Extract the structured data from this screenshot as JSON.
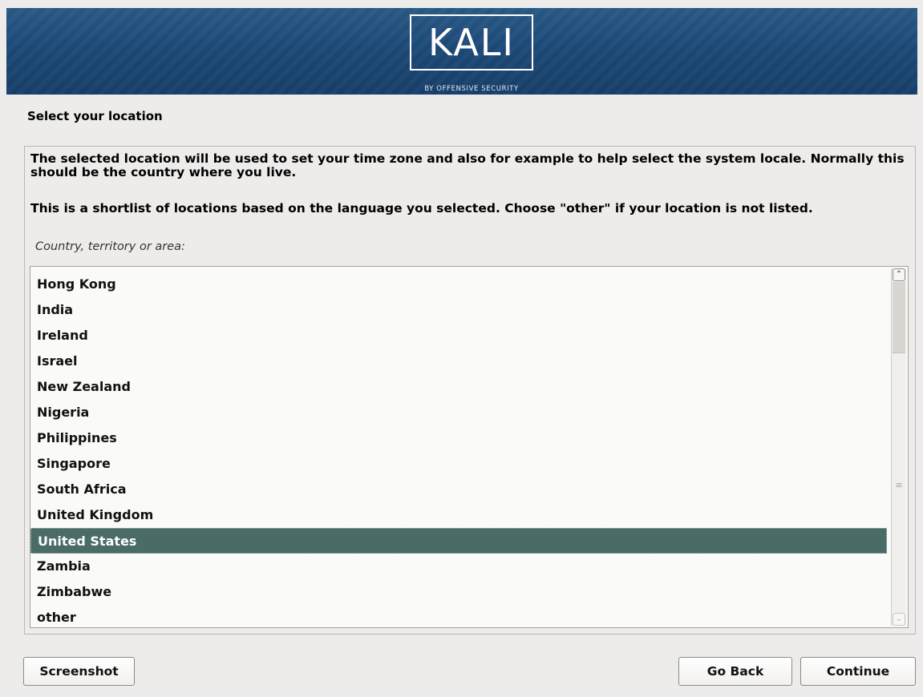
{
  "header": {
    "logo_text": "KALI",
    "logo_subtitle": "BY OFFENSIVE SECURITY"
  },
  "page": {
    "title": "Select your location",
    "description_1": "The selected location will be used to set your time zone and also for example to help select the system locale. Normally this should be the country where you live.",
    "description_2": "This is a shortlist of locations based on the language you selected. Choose \"other\" if your location is not listed.",
    "list_label": "Country, territory or area:"
  },
  "locations": {
    "items": [
      {
        "label": "Hong Kong"
      },
      {
        "label": "India"
      },
      {
        "label": "Ireland"
      },
      {
        "label": "Israel"
      },
      {
        "label": "New Zealand"
      },
      {
        "label": "Nigeria"
      },
      {
        "label": "Philippines"
      },
      {
        "label": "Singapore"
      },
      {
        "label": "South Africa"
      },
      {
        "label": "United Kingdom"
      },
      {
        "label": "United States",
        "selected": true
      },
      {
        "label": "Zambia"
      },
      {
        "label": "Zimbabwe"
      },
      {
        "label": "other"
      }
    ],
    "selected": "United States"
  },
  "buttons": {
    "screenshot": "Screenshot",
    "go_back": "Go Back",
    "continue": "Continue"
  },
  "colors": {
    "banner": "#1d4a78",
    "selection": "#4a6b66",
    "background": "#edeceb"
  },
  "icons": {
    "scroll_up": "chevron-up-icon",
    "scroll_down": "chevron-down-icon",
    "scroll_grip": "grip-icon"
  }
}
